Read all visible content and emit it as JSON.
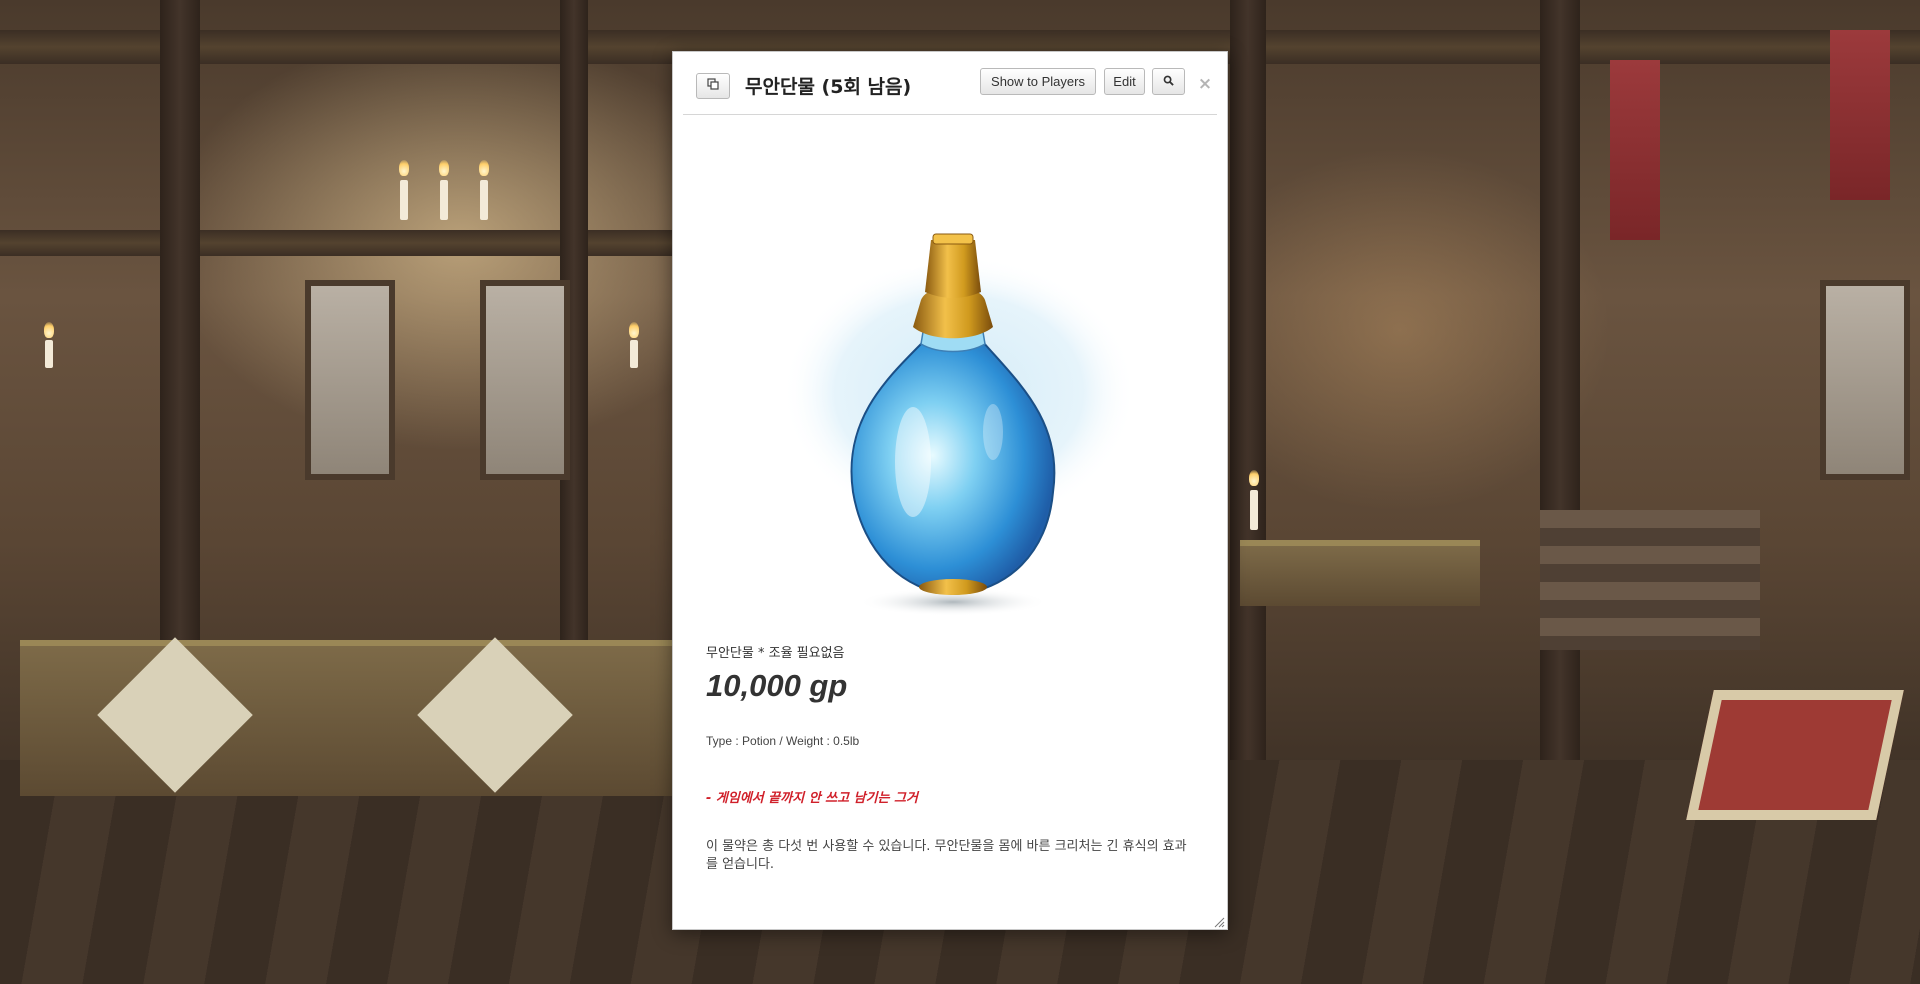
{
  "dialog": {
    "title": "무안단물 (5회 남음)",
    "buttons": {
      "popout_icon": "popout-icon",
      "show_to_players": "Show to Players",
      "edit": "Edit",
      "search_icon": "magnifier-icon",
      "close": "×"
    }
  },
  "item": {
    "image_icon": "blue-potion-bottle-illustration",
    "subtitle": "무안단물 * 조율 필요없음",
    "price": "10,000 gp",
    "type_line": "Type : Potion / Weight : 0.5lb",
    "note": "- 게임에서 끝까지 안 쓰고 남기는 그거",
    "description": "이 물약은 총 다섯 번 사용할 수 있습니다. 무안단물을 몸에 바른 크리처는 긴 휴식의 효과를 얻습니다."
  },
  "colors": {
    "note_red": "#d0202a",
    "potion_blue": "#3aa8e0",
    "cap_gold": "#d09a1e"
  }
}
